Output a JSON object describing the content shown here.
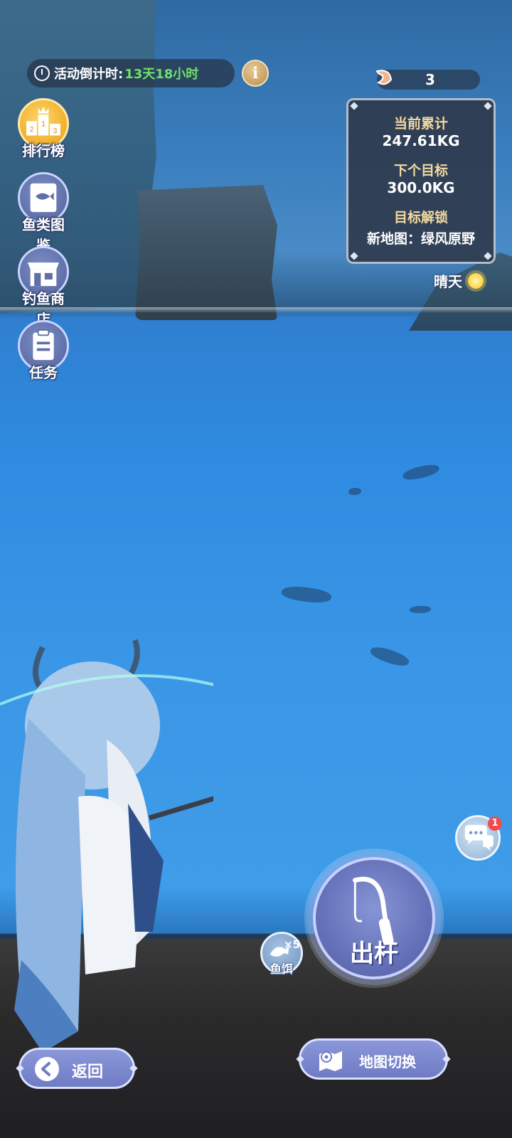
{
  "hud": {
    "countdown_label": "活动倒计时:",
    "countdown_value": "13天18小时",
    "info_icon": "i",
    "bait_count": "3"
  },
  "side_menu": {
    "leaderboard": "排行榜",
    "fish_guide": "鱼类图鉴",
    "fishing_shop": "钓鱼商店",
    "tasks": "任务"
  },
  "progress_panel": {
    "current_total_label": "当前累计",
    "current_total_value": "247.61KG",
    "next_goal_label": "下个目标",
    "next_goal_value": "300.0KG",
    "unlock_label": "目标解锁",
    "unlock_value": "新地图：绿风原野"
  },
  "weather": {
    "label": "晴天",
    "icon": "sun-icon"
  },
  "chat": {
    "badge_count": "1",
    "icon": "chat-bubble-icon"
  },
  "actions": {
    "cast_label": "出杆",
    "bait_multiplier": "×5",
    "bait_label": "鱼饵",
    "back_label": "返回",
    "map_switch_label": "地图切换"
  },
  "colors": {
    "countdown_value": "#6ee06a",
    "panel_label": "#f3d9a0",
    "button_primary": "#6f7bc4",
    "badge_red": "#ef4d4d"
  }
}
